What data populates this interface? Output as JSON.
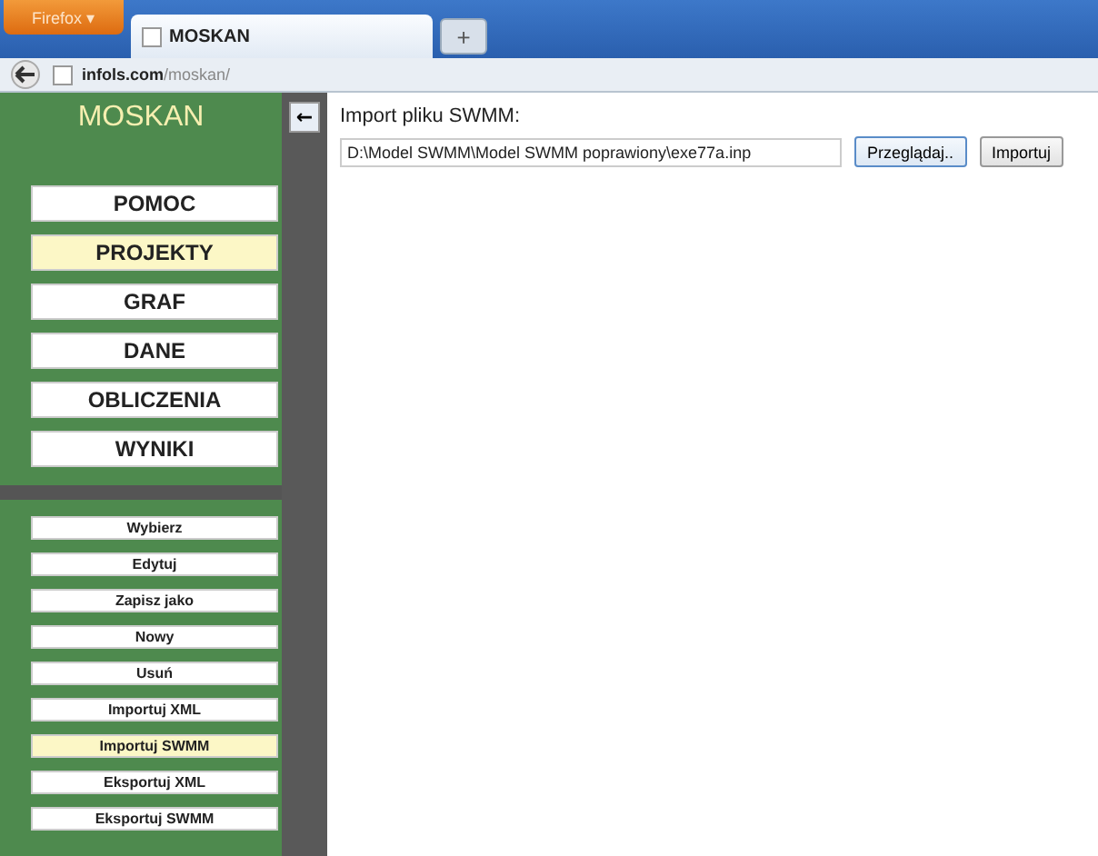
{
  "browser": {
    "menu_button": "Firefox ▾",
    "tab_title": "MOSKAN",
    "new_tab": "+",
    "url_domain": "infols.com",
    "url_path": "/moskan/"
  },
  "sidebar": {
    "title": "MOSKAN",
    "collapse": "←",
    "menu": [
      {
        "label": "POMOC",
        "selected": false
      },
      {
        "label": "PROJEKTY",
        "selected": true
      },
      {
        "label": "GRAF",
        "selected": false
      },
      {
        "label": "DANE",
        "selected": false
      },
      {
        "label": "OBLICZENIA",
        "selected": false
      },
      {
        "label": "WYNIKI",
        "selected": false
      }
    ],
    "submenu": [
      {
        "label": "Wybierz",
        "selected": false
      },
      {
        "label": "Edytuj",
        "selected": false
      },
      {
        "label": "Zapisz jako",
        "selected": false
      },
      {
        "label": "Nowy",
        "selected": false
      },
      {
        "label": "Usuń",
        "selected": false
      },
      {
        "label": "Importuj XML",
        "selected": false
      },
      {
        "label": "Importuj SWMM",
        "selected": true
      },
      {
        "label": "Eksportuj XML",
        "selected": false
      },
      {
        "label": "Eksportuj SWMM",
        "selected": false
      }
    ]
  },
  "import": {
    "heading": "Import pliku SWMM:",
    "file_path": "D:\\Model SWMM\\Model SWMM poprawiony\\exe77a.inp",
    "browse_button": "Przeglądaj..",
    "import_button": "Importuj"
  }
}
